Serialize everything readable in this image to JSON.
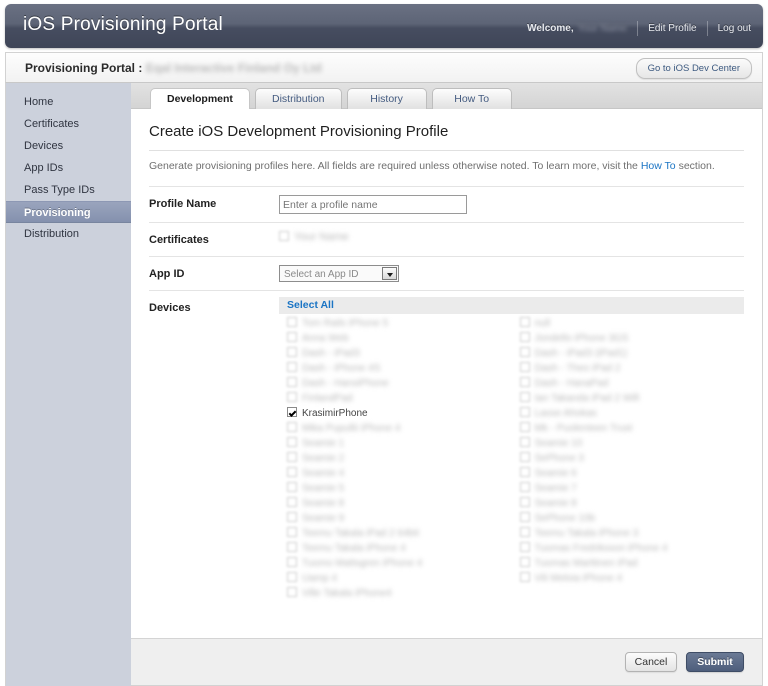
{
  "header": {
    "brand": "iOS Provisioning Portal",
    "welcome_label": "Welcome,",
    "user_name": "Your Name",
    "edit_profile": "Edit Profile",
    "log_out": "Log out"
  },
  "subheader": {
    "title": "Provisioning Portal",
    "separator": " : ",
    "team_name": "Eqal Interactive Finland Oy Ltd",
    "dev_center_button": "Go to iOS Dev Center"
  },
  "sidebar": {
    "items": [
      {
        "label": "Home",
        "active": false
      },
      {
        "label": "Certificates",
        "active": false
      },
      {
        "label": "Devices",
        "active": false
      },
      {
        "label": "App IDs",
        "active": false
      },
      {
        "label": "Pass Type IDs",
        "active": false
      },
      {
        "label": "Provisioning",
        "active": true
      },
      {
        "label": "Distribution",
        "active": false
      }
    ]
  },
  "tabs": [
    {
      "label": "Development",
      "active": true
    },
    {
      "label": "Distribution",
      "active": false
    },
    {
      "label": "History",
      "active": false
    },
    {
      "label": "How To",
      "active": false
    }
  ],
  "main": {
    "page_title": "Create iOS Development Provisioning Profile",
    "intro_before": "Generate provisioning profiles here. All fields are required unless otherwise noted. To learn more, visit the ",
    "intro_link": "How To",
    "intro_after": " section.",
    "fields": {
      "profile_name_label": "Profile Name",
      "profile_name_value": "",
      "profile_name_placeholder": "Enter a profile name",
      "certificates_label": "Certificates",
      "certificate_item": "Your Name",
      "certificate_checked": false,
      "app_id_label": "App ID",
      "app_id_selected": "Select an App ID",
      "devices_label": "Devices",
      "select_all_label": "Select All"
    },
    "devices": {
      "left_column": [
        {
          "name": "Tom Rails iPhone 5",
          "checked": false,
          "redacted": true
        },
        {
          "name": "Anna Web",
          "checked": false,
          "redacted": true
        },
        {
          "name": "Dash - iPad3",
          "checked": false,
          "redacted": true
        },
        {
          "name": "Dash - iPhone 4S",
          "checked": false,
          "redacted": true
        },
        {
          "name": "Dash - HansiPhone",
          "checked": false,
          "redacted": true
        },
        {
          "name": "FinlandPad",
          "checked": false,
          "redacted": true
        },
        {
          "name": "KrasimirPhone",
          "checked": true,
          "redacted": false
        },
        {
          "name": "Mika Pupullii iPhone 4",
          "checked": false,
          "redacted": true
        },
        {
          "name": "Seamie 1",
          "checked": false,
          "redacted": true
        },
        {
          "name": "Seamie 2",
          "checked": false,
          "redacted": true
        },
        {
          "name": "Seamie 4",
          "checked": false,
          "redacted": true
        },
        {
          "name": "Seamie 5",
          "checked": false,
          "redacted": true
        },
        {
          "name": "Seamie 8",
          "checked": false,
          "redacted": true
        },
        {
          "name": "Seamie 9",
          "checked": false,
          "redacted": true
        },
        {
          "name": "Teemu Takala iPad 2 64bit",
          "checked": false,
          "redacted": true
        },
        {
          "name": "Teemu Takala iPhone 4",
          "checked": false,
          "redacted": true
        },
        {
          "name": "Tuomo Mattsgren iPhone 4",
          "checked": false,
          "redacted": true
        },
        {
          "name": "Uamp 4",
          "checked": false,
          "redacted": true
        },
        {
          "name": "Ville Takala iPhone4",
          "checked": false,
          "redacted": true
        }
      ],
      "right_column": [
        {
          "name": "null",
          "checked": false,
          "redacted": true
        },
        {
          "name": "Jondello iPhone 3GS",
          "checked": false,
          "redacted": true
        },
        {
          "name": "Dash - iPad3 (iPad1)",
          "checked": false,
          "redacted": true
        },
        {
          "name": "Dash - Theo iPad 2",
          "checked": false,
          "redacted": true
        },
        {
          "name": "Dash - HanaPad",
          "checked": false,
          "redacted": true
        },
        {
          "name": "Ian Takanda iPad 2 Wifi",
          "checked": false,
          "redacted": true
        },
        {
          "name": "Lasse Ahokas",
          "checked": false,
          "redacted": true
        },
        {
          "name": "Mk - Puolenteen Trust",
          "checked": false,
          "redacted": true
        },
        {
          "name": "Seamie 10",
          "checked": false,
          "redacted": true
        },
        {
          "name": "SePhone 3",
          "checked": false,
          "redacted": true
        },
        {
          "name": "Seamie 6",
          "checked": false,
          "redacted": true
        },
        {
          "name": "Seamie 7",
          "checked": false,
          "redacted": true
        },
        {
          "name": "Seamie 8",
          "checked": false,
          "redacted": true
        },
        {
          "name": "SePhone 10b",
          "checked": false,
          "redacted": true
        },
        {
          "name": "Teemu Takala iPhone 3",
          "checked": false,
          "redacted": true
        },
        {
          "name": "Tuomas Fredriksson iPhone 4",
          "checked": false,
          "redacted": true
        },
        {
          "name": "Tuomas Marttinen iPad",
          "checked": false,
          "redacted": true
        },
        {
          "name": "Vili Meloia iPhone 4",
          "checked": false,
          "redacted": true
        }
      ]
    }
  },
  "footer": {
    "cancel_label": "Cancel",
    "submit_label": "Submit"
  },
  "colors": {
    "header_gradient_top": "#6a7183",
    "header_gradient_bottom": "#3f4557",
    "sidebar_bg": "#ccd1dc",
    "sidebar_active": "#8491ae",
    "link_blue": "#1a74c4",
    "submit_blue": "#4e5e7c"
  }
}
